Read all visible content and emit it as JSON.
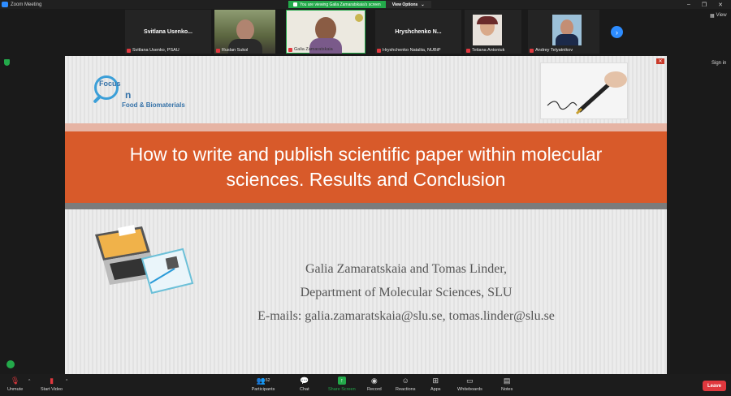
{
  "window": {
    "title": "Zoom Meeting",
    "minimize": "–",
    "maximize": "❐",
    "close": "✕",
    "view_label": "View"
  },
  "banner": {
    "viewing": "You are viewing Galia Zamaratskaia's screen",
    "options": "View Options"
  },
  "participants": [
    {
      "tile_name": "Svitlana  Usenko...",
      "label": "Svitlana Usenko, PSAU"
    },
    {
      "tile_name": "",
      "label": "Ruslan Sukol"
    },
    {
      "tile_name": "",
      "label": "Galia Zamaratskaia"
    },
    {
      "tile_name": "Hryshchenko  N...",
      "label": "Hryshchenko Nataliia, NUBiP"
    },
    {
      "tile_name": "",
      "label": "Tetiana Antoniuk"
    },
    {
      "tile_name": "",
      "label": "Andrey Telyatnikov"
    }
  ],
  "side": {
    "signin": "Sign in"
  },
  "slide": {
    "logo_focus": "Focus",
    "logo_on": "n",
    "logo_sub": "Food & Biomaterials",
    "title": "How to write and publish scientific paper within molecular sciences. Results and Conclusion",
    "authors": "Galia Zamaratskaia and Tomas Linder,",
    "department": "Department of Molecular Sciences, SLU",
    "emails": "E-mails: galia.zamaratskaia@slu.se, tomas.linder@slu.se"
  },
  "toolbar": {
    "unmute": "Unmute",
    "start_video": "Start Video",
    "participants": "Participants",
    "participants_count": "62",
    "chat": "Chat",
    "share_screen": "Share Screen",
    "record": "Record",
    "reactions": "Reactions",
    "apps": "Apps",
    "whiteboards": "Whiteboards",
    "notes": "Notes",
    "leave": "Leave"
  },
  "colors": {
    "accent": "#2d8cff",
    "green": "#23a94a",
    "slide_band": "#d85a2a",
    "leave": "#e0383e"
  }
}
